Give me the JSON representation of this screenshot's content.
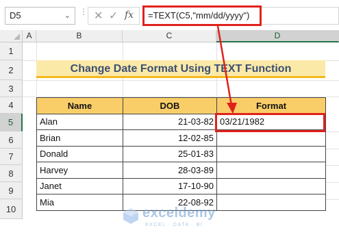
{
  "formula_bar": {
    "name_box": "D5",
    "cancel_symbol": "✕",
    "enter_symbol": "✓",
    "fx_label": "fx",
    "formula": "=TEXT(C5,\"mm/dd/yyyy\")"
  },
  "columns": [
    "A",
    "B",
    "C",
    "D"
  ],
  "rows": [
    "1",
    "2",
    "3",
    "4",
    "5",
    "6",
    "7",
    "8",
    "9",
    "10"
  ],
  "selected_cell": {
    "column": "D",
    "row": "5"
  },
  "title": "Change Date Format Using TEXT Function",
  "table": {
    "headers": {
      "name": "Name",
      "dob": "DOB",
      "format": "Format"
    },
    "rows": [
      {
        "name": "Alan",
        "dob": "21-03-82",
        "format": "03/21/1982"
      },
      {
        "name": "Brian",
        "dob": "12-02-85",
        "format": ""
      },
      {
        "name": "Donald",
        "dob": "25-01-83",
        "format": ""
      },
      {
        "name": "Harvey",
        "dob": "28-03-89",
        "format": ""
      },
      {
        "name": "Janet",
        "dob": "17-10-90",
        "format": ""
      },
      {
        "name": "Mia",
        "dob": "22-08-92",
        "format": ""
      }
    ]
  },
  "watermark": {
    "brand": "exceldemy",
    "tagline": "EXCEL · DATA · BI"
  },
  "colors": {
    "highlight_red": "#e0211c",
    "title_fill": "#fbe9a8",
    "title_underline": "#f3b81d",
    "header_fill": "#f9ce69",
    "title_text": "#3a4f72",
    "selection_green": "#217346"
  }
}
